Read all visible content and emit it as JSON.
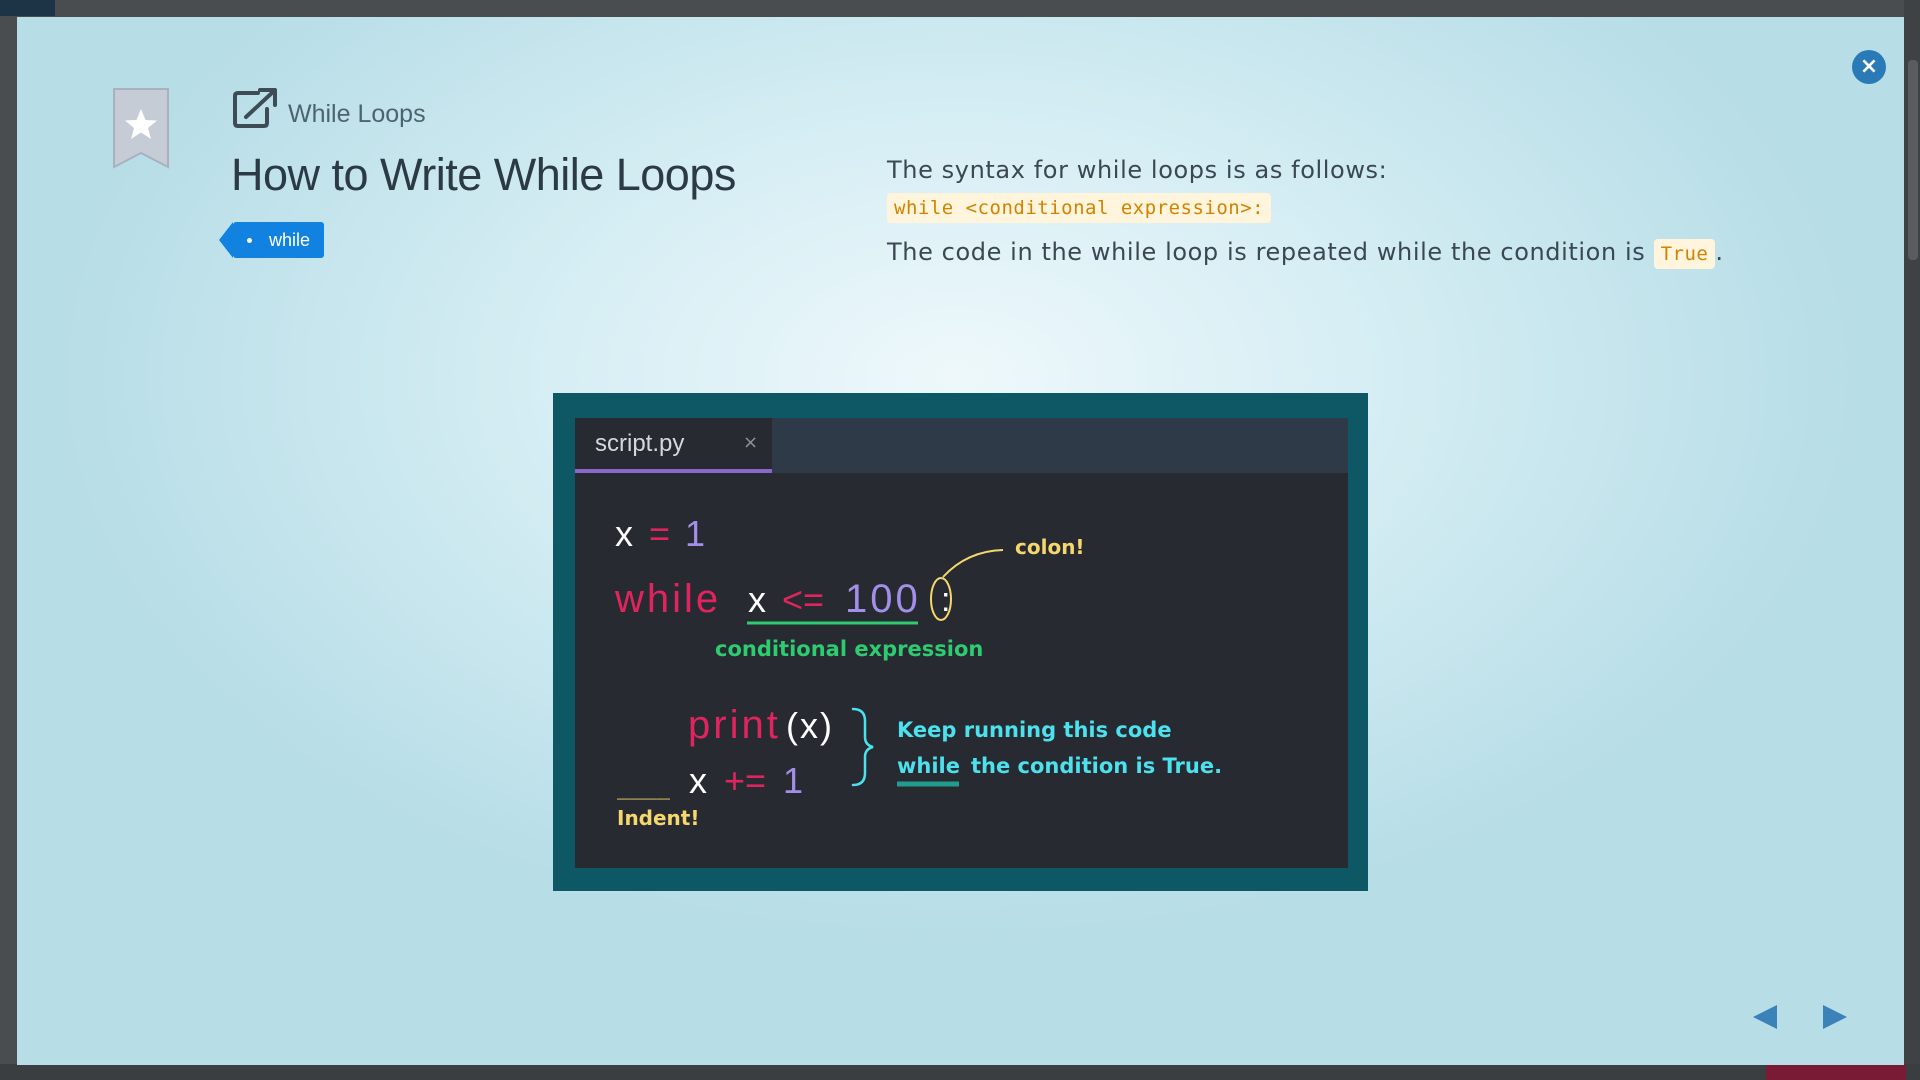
{
  "modal": {
    "close_icon": "×",
    "topic_label": "While Loops",
    "title": "How to Write While Loops",
    "tag": "while"
  },
  "description": {
    "line1": "The syntax for while loops is as follows:",
    "syntax_code": "while <conditional expression>:",
    "line3_prefix": "The code in the while loop is repeated while the condition is ",
    "line3_code": "True",
    "line3_suffix": "."
  },
  "editor": {
    "tab_name": "script.py",
    "tab_close": "×",
    "code": {
      "line1_var": "x",
      "line1_op": "=",
      "line1_val": "1",
      "line2_kw": "while",
      "line2_var": "x",
      "line2_op": "<=",
      "line2_val": "100",
      "line2_colon": ":",
      "line3_fn": "print",
      "line3_args": "(x)",
      "line4_var": "x",
      "line4_op": "+=",
      "line4_val": "1"
    },
    "annotations": {
      "colon": "colon!",
      "conditional": "conditional expression",
      "keep_running_1": "Keep running this code",
      "keep_running_2_kw": "while",
      "keep_running_2_rest": "the condition is True.",
      "indent": "Indent!"
    }
  },
  "colors": {
    "accent": "#1282e0",
    "close_button": "#2a7ab8",
    "keyword": "#e0245e",
    "number": "#a38ee8",
    "annotation_yellow": "#f5d76e",
    "annotation_green": "#2ecc71",
    "annotation_cyan": "#4de1ee"
  },
  "icons": [
    "close-icon",
    "bookmark-star-icon",
    "external-link-icon",
    "prev-arrow-icon",
    "next-arrow-icon"
  ]
}
